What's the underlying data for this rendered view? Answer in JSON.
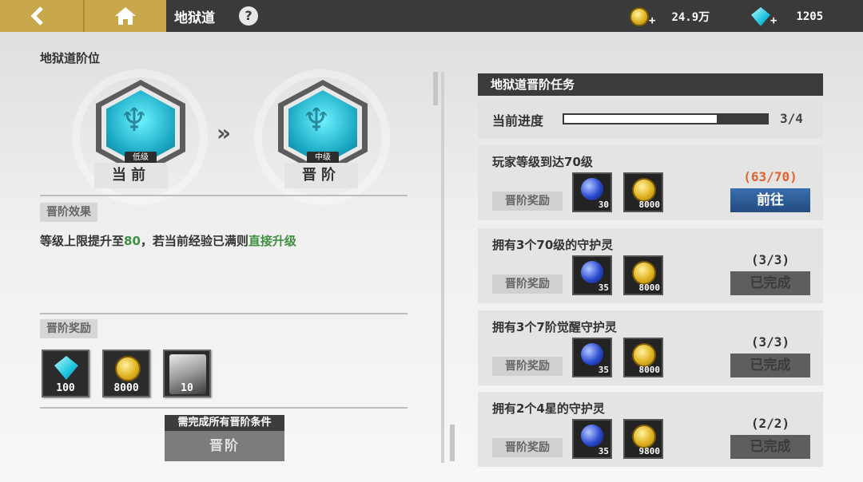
{
  "topbar": {
    "title": "地狱道",
    "help": "?",
    "gold_amount": "24.9万",
    "gem_amount": "1205",
    "plus": "+"
  },
  "left": {
    "rank_title": "地狱道阶位",
    "current": {
      "label": "当前",
      "rank_text": "低级"
    },
    "next": {
      "label": "晋阶",
      "rank_text": "中级"
    },
    "arrow": "»",
    "effect_tag": "晋阶效果",
    "effect_parts": [
      "等级上限提升至",
      "80",
      "，若当前经验已满则",
      "直接升级"
    ],
    "reward_tag": "晋阶奖励",
    "rewards": [
      {
        "icon": "gem-icon",
        "count": "100"
      },
      {
        "icon": "gold-coin-icon",
        "count": "8000"
      },
      {
        "icon": "character-icon",
        "count": "10"
      }
    ],
    "requirement": "需完成所有晋阶条件",
    "advance_button": "晋阶"
  },
  "right": {
    "header": "地狱道晋阶任务",
    "progress_label": "当前进度",
    "progress_text": "3/4",
    "progress_fraction": 0.75,
    "reward_tag": "晋阶奖励",
    "tasks": [
      {
        "title": "玩家等级到达70级",
        "count": "(63/70)",
        "count_color": "#e0622e",
        "button": "前往",
        "state": "go",
        "rewards": [
          "30",
          "8000"
        ]
      },
      {
        "title": "拥有3个70级的守护灵",
        "count": "(3/3)",
        "count_color": "#333333",
        "button": "已完成",
        "state": "done",
        "rewards": [
          "35",
          "8000"
        ]
      },
      {
        "title": "拥有3个7阶觉醒守护灵",
        "count": "(3/3)",
        "count_color": "#333333",
        "button": "已完成",
        "state": "done",
        "rewards": [
          "35",
          "8000"
        ]
      },
      {
        "title": "拥有2个4星的守护灵",
        "count": "(2/2)",
        "count_color": "#333333",
        "button": "已完成",
        "state": "done",
        "rewards": [
          "35",
          "9800"
        ]
      }
    ]
  }
}
